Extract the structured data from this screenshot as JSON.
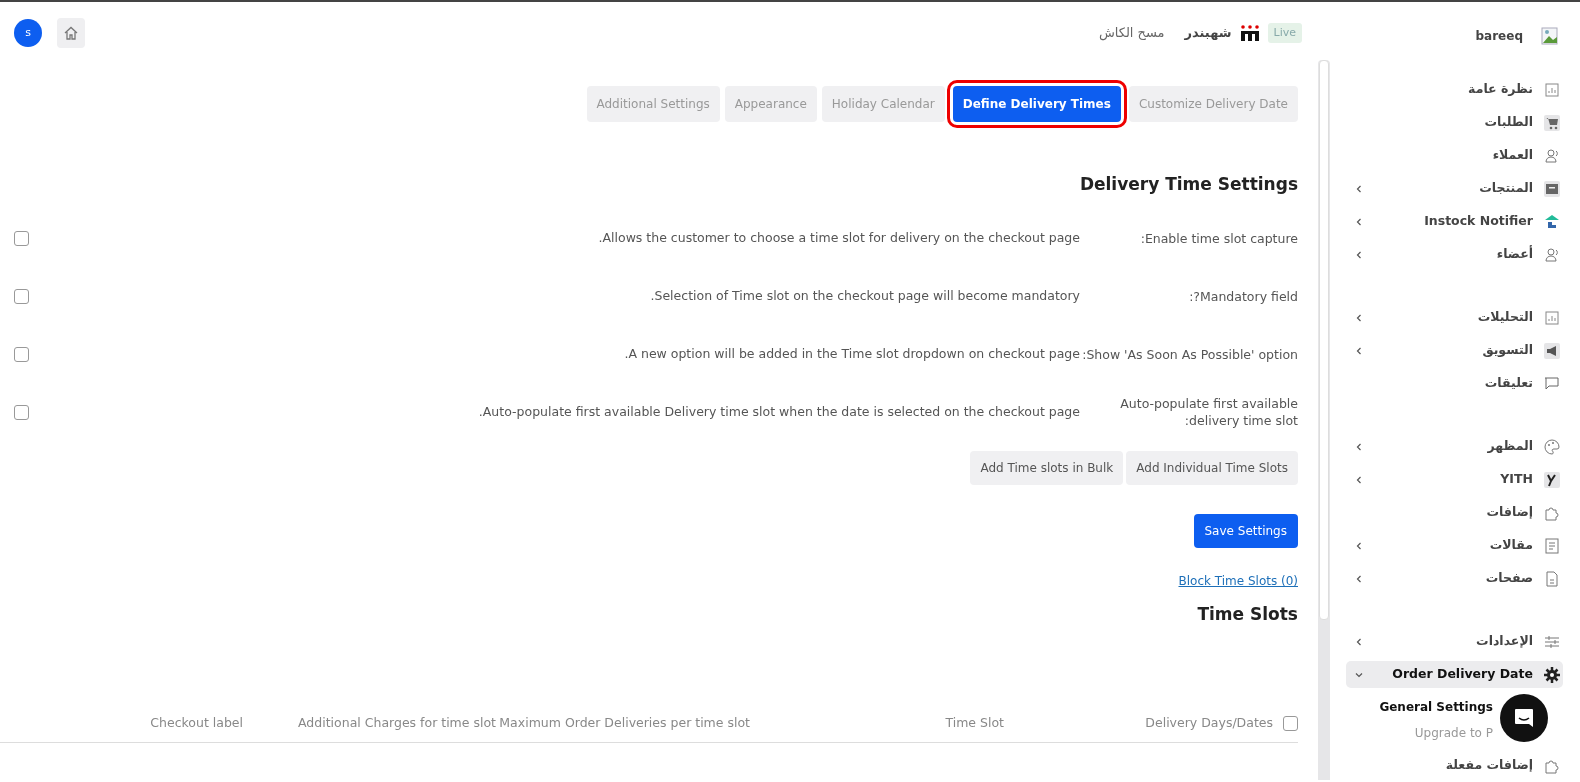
{
  "header": {
    "site_name": "bareeq",
    "live_badge": "Live",
    "brand_name": "شهبندر",
    "clear_cache": "مسح الكاش",
    "avatar_letter": "s"
  },
  "sidebar": {
    "groups": [
      {
        "items": [
          {
            "label": "نظرة عامة",
            "kind": "link",
            "selected": false
          },
          {
            "label": "الطلبات",
            "kind": "link",
            "selected": false
          },
          {
            "label": "العملاء",
            "kind": "link",
            "selected": false
          },
          {
            "label": "المنتجات",
            "kind": "submenu",
            "expanded": false,
            "selected": false
          },
          {
            "label": "Instock Notifier",
            "kind": "submenu",
            "expanded": false,
            "selected": false
          },
          {
            "label": "أعضاء",
            "kind": "submenu",
            "expanded": false,
            "selected": false
          }
        ]
      },
      {
        "items": [
          {
            "label": "التحليلات",
            "kind": "submenu",
            "expanded": false,
            "selected": false
          },
          {
            "label": "التسويق",
            "kind": "submenu",
            "expanded": false,
            "selected": false
          },
          {
            "label": "تعليقات",
            "kind": "link",
            "selected": false
          }
        ]
      },
      {
        "items": [
          {
            "label": "المظهر",
            "kind": "submenu",
            "expanded": false,
            "selected": false
          },
          {
            "label": "YITH",
            "kind": "submenu",
            "expanded": false,
            "selected": false
          },
          {
            "label": "إضافات",
            "kind": "link",
            "selected": false
          },
          {
            "label": "مقالات",
            "kind": "submenu",
            "expanded": false,
            "selected": false
          },
          {
            "label": "صفحات",
            "kind": "submenu",
            "expanded": false,
            "selected": false
          }
        ]
      },
      {
        "items": [
          {
            "label": "الإعدادات",
            "kind": "submenu",
            "expanded": false,
            "selected": false
          },
          {
            "label": "Order Delivery Date",
            "kind": "submenu",
            "expanded": true,
            "selected": true,
            "children": [
              {
                "label": "General Settings",
                "selected": true
              },
              {
                "label": "Upgrade to P",
                "selected": false
              }
            ]
          },
          {
            "label": "إضافات مفعلة",
            "kind": "link",
            "selected": false
          }
        ]
      }
    ]
  },
  "tabs": [
    {
      "label": "Customize Delivery Date",
      "selected": false
    },
    {
      "label": "Define Delivery Times",
      "selected": true
    },
    {
      "label": "Holiday Calendar",
      "selected": false
    },
    {
      "label": "Appearance",
      "selected": false
    },
    {
      "label": "Additional Settings",
      "selected": false
    }
  ],
  "settings_title": "Delivery Time Settings",
  "settings": [
    {
      "label": "Enable time slot capture:",
      "description": "Allows the customer to choose a time slot for delivery on the checkout page.",
      "checked": false
    },
    {
      "label": "Mandatory field?:",
      "description": "Selection of Time slot on the checkout page will become mandatory.",
      "checked": false
    },
    {
      "label": "Show 'As Soon As Possible' option:",
      "description": "A new option will be added in the Time slot dropdown on checkout page.",
      "checked": false
    },
    {
      "label": "Auto-populate first available delivery time slot:",
      "description": "Auto-populate first available Delivery time slot when the date is selected on the checkout page.",
      "checked": false
    }
  ],
  "slot_buttons": [
    "Add Individual Time Slots",
    "Add Time slots in Bulk"
  ],
  "save_button": "Save Settings",
  "block_link": "Block Time Slots (0)",
  "time_slots": {
    "title": "Time Slots",
    "select_all_checked": false,
    "columns": [
      "Delivery Days/Dates",
      "Time Slot",
      "Maximum Order Deliveries per time slot",
      "Additional Charges for time slot",
      "Checkout label"
    ]
  }
}
